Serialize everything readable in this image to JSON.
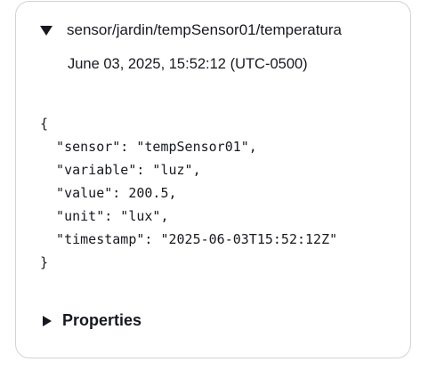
{
  "message": {
    "topic": "sensor/jardin/tempSensor01/temperatura",
    "timestamp": "June 03, 2025, 15:52:12 (UTC-0500)",
    "expand_icon": "caret-down-icon",
    "payload": "{\n  \"sensor\": \"tempSensor01\",\n  \"variable\": \"luz\",\n  \"value\": 200.5,\n  \"unit\": \"lux\",\n  \"timestamp\": \"2025-06-03T15:52:12Z\"\n}"
  },
  "properties": {
    "label": "Properties",
    "expand_icon": "caret-right-icon"
  }
}
